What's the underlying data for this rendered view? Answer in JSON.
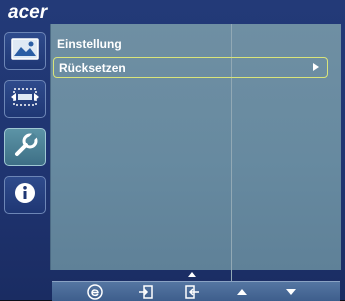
{
  "brand": "acer",
  "sidebar": {
    "items": [
      {
        "icon": "picture-icon"
      },
      {
        "icon": "screen-size-icon"
      },
      {
        "icon": "wrench-icon",
        "active": true
      },
      {
        "icon": "info-icon"
      }
    ]
  },
  "menu": {
    "title": "Einstellung",
    "items": [
      {
        "label": "Rücksetzen"
      }
    ]
  },
  "bottom_bar": {
    "buttons": [
      {
        "icon": "e-key-icon"
      },
      {
        "icon": "exit-icon"
      },
      {
        "icon": "enter-icon"
      },
      {
        "icon": "up-arrow-icon"
      },
      {
        "icon": "down-arrow-icon"
      }
    ]
  },
  "colors": {
    "accent": "#d9e47a",
    "panel": "#6f8fa3",
    "background": "#233a78"
  }
}
